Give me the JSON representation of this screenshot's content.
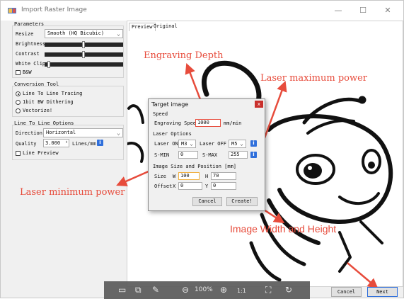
{
  "window": {
    "title": "Import Raster Image",
    "controls": {
      "minimize": "—",
      "maximize": "☐",
      "close": "✕"
    }
  },
  "parameters": {
    "heading": "Parameters",
    "resize_label": "Resize",
    "resize_value": "Smooth (HQ Bicubic)",
    "brightness_label": "Brightness",
    "contrast_label": "Contrast",
    "white_clip_label": "White Clip",
    "bw_label": "B&W",
    "bw_checked": false
  },
  "conversion_tool": {
    "heading": "Conversion Tool",
    "options": [
      {
        "label": "Line To Line Tracing",
        "selected": true
      },
      {
        "label": "1bit BW Dithering",
        "selected": false
      },
      {
        "label": "Vectorize!",
        "selected": false
      }
    ]
  },
  "line_options": {
    "heading": "Line To Line Options",
    "direction_label": "Direction",
    "direction_value": "Horizontal",
    "quality_label": "Quality",
    "quality_value": "3.000",
    "quality_unit": "Lines/mm",
    "line_preview_label": "Line Preview",
    "line_preview_checked": false
  },
  "tabs": [
    {
      "label": "Preview",
      "active": true
    },
    {
      "label": "Original",
      "active": false
    }
  ],
  "dialog": {
    "title": "Target image",
    "close_icon": "x",
    "speed_heading": "Speed",
    "engraving_speed_label": "Engraving Speed",
    "engraving_speed_value": "1000",
    "engraving_speed_unit": "mm/min",
    "laser_heading": "Laser Options",
    "laser_on_label": "Laser ON",
    "laser_on_value": "M3",
    "laser_off_label": "Laser OFF",
    "laser_off_value": "M5",
    "smin_label": "S-MIN",
    "smin_value": "0",
    "smax_label": "S-MAX",
    "smax_value": "255",
    "size_heading": "Image Size and Position [mm]",
    "size_label": "Size",
    "w_label": "W",
    "w_value": "100",
    "h_label": "H",
    "h_value": "70",
    "offset_label": "Offset",
    "x_label": "X",
    "x_value": "0",
    "y_label": "Y",
    "y_value": "0",
    "cancel_label": "Cancel",
    "create_label": "Create!"
  },
  "annotations": {
    "engraving_depth": "Engraving Depth",
    "laser_max": "Laser maximum power",
    "laser_min": "Laser minimum power",
    "image_wh": "Image Width and Height",
    "color": "#e74c3c"
  },
  "viewer_toolbar": {
    "zoom": "100%",
    "icons": [
      "save-icon",
      "copy-icon",
      "edit-icon",
      "zoom-out-icon",
      "zoom-in-icon",
      "actual-size-icon",
      "fit-icon",
      "rotate-icon"
    ]
  },
  "footer": {
    "cancel_label": "Cancel",
    "next_label": "Next"
  },
  "colors": {
    "window_bg": "#f0f0f0",
    "info_blue": "#2f6fdb",
    "close_red": "#c9302c",
    "field_highlight": "#f0b040"
  }
}
